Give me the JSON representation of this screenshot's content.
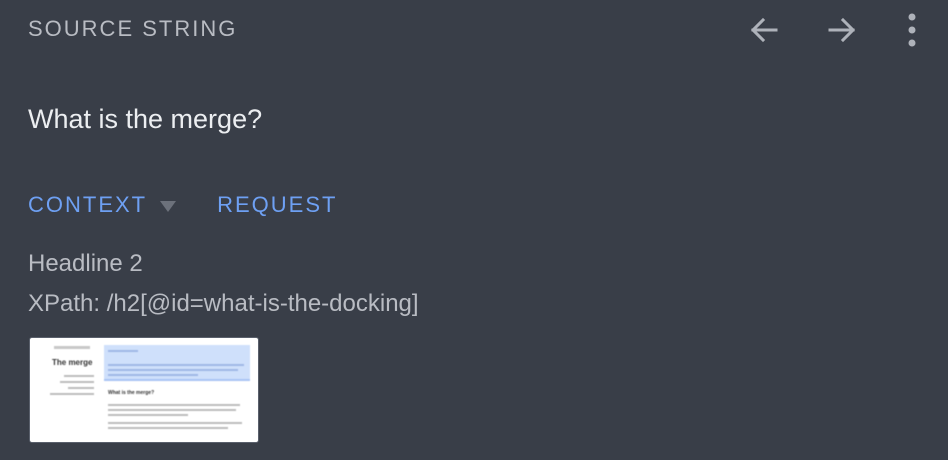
{
  "header": {
    "title": "SOURCE STRING",
    "icons": [
      "arrow-left-icon",
      "arrow-right-icon",
      "more-vertical-icon"
    ]
  },
  "source": {
    "text": "What is the merge?"
  },
  "tabs": [
    {
      "label": "CONTEXT",
      "has_dropdown": true
    },
    {
      "label": "REQUEST",
      "has_dropdown": false
    }
  ],
  "context": {
    "element_type": "Headline 2",
    "xpath": "XPath: /h2[@id=what-is-the-docking]"
  },
  "thumbnail": {
    "left_title": "The merge",
    "heading": "What is the merge?"
  },
  "colors": {
    "background": "#393e48",
    "accent": "#6ea0f3",
    "muted_text": "#b9bcc3",
    "primary_text": "#eceef1"
  }
}
